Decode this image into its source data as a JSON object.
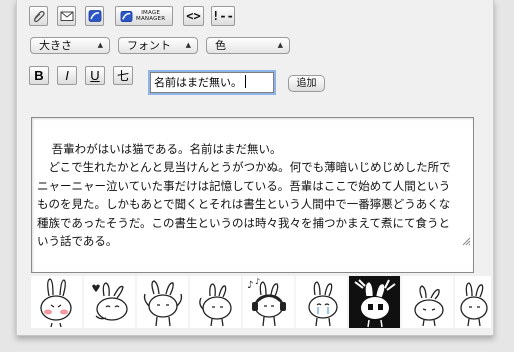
{
  "toolbar": {
    "buttons": [
      {
        "name": "attach-icon"
      },
      {
        "name": "mail-icon"
      },
      {
        "name": "image-icon"
      },
      {
        "name": "image-manager-button",
        "label_line1": "IMAGE",
        "label_line2": "MANAGER"
      },
      {
        "name": "code-button",
        "label": "<>"
      },
      {
        "name": "comment-button",
        "label": "!--"
      }
    ]
  },
  "selects": {
    "size": "大きさ",
    "font": "フォント",
    "color": "色"
  },
  "format": {
    "bold": "B",
    "italic": "I",
    "underline": "U",
    "strike": "七"
  },
  "name_field": {
    "value": "名前はまだ無い。"
  },
  "add_button": "追加",
  "editor": {
    "text": "吾輩わがはいは猫である。名前はまだ無い。\n　どこで生れたかとんと見当けんとうがつかぬ。何でも薄暗いじめじめした所で\nニャーニャー泣いていた事だけは記憶している。吾輩はここで始めて人間という\nものを見た。しかもあとで聞くとそれは書生という人間中で一番獰悪どうあくな\n種族であったそうだ。この書生というのは時々我々を捕つかまえて煮にて食うと\nいう話である。"
  },
  "stickers": [
    {
      "name": "sticker-rabbit-blush-icon"
    },
    {
      "name": "sticker-rabbit-heart-icon"
    },
    {
      "name": "sticker-rabbit-arms-up-icon"
    },
    {
      "name": "sticker-rabbit-wave-icon"
    },
    {
      "name": "sticker-rabbit-headphones-icon"
    },
    {
      "name": "sticker-rabbit-tears-icon"
    },
    {
      "name": "sticker-rabbit-shocked-icon"
    },
    {
      "name": "sticker-rabbit-sulk-icon"
    },
    {
      "name": "sticker-rabbit-peek-icon"
    }
  ]
}
